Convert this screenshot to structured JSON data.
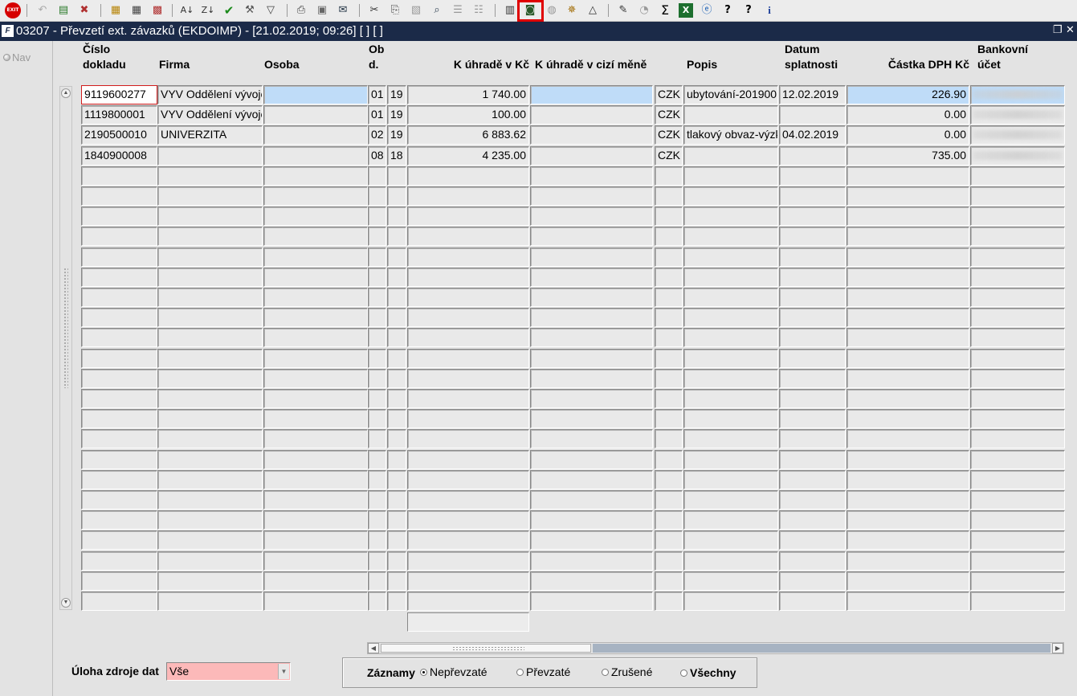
{
  "toolbar": {
    "exit_label": "EXIT",
    "icons": [
      "exit-icon",
      "back-icon",
      "add-record-icon",
      "delete-record-icon",
      "copy-record-icon",
      "copy-record-2-icon",
      "cancel-record-icon",
      "sort-ascending-icon",
      "sort-descending-icon",
      "checkmark-icon",
      "wrench-icon",
      "filter-icon",
      "print-icon",
      "print-preview-icon",
      "mail-icon",
      "cut-icon",
      "copy-icon",
      "paste-icon",
      "search-icon",
      "indent-icon",
      "align-icon",
      "calculator-icon",
      "save-icon",
      "globe-icon",
      "settings-wheel-icon",
      "triangle-icon",
      "edit-note-icon",
      "chart-icon",
      "sum-icon",
      "excel-icon",
      "browser-icon",
      "help-context-icon",
      "help-icon",
      "info-icon"
    ],
    "highlighted_icon": "save-icon"
  },
  "titlebar": {
    "title": "03207 - Převzetí ext. závazků (EKDOIMP) - [21.02.2019; 09:26]  [ ]  [ ]",
    "app_icon": "F",
    "restore_glyph": "❐",
    "close_glyph": "✕"
  },
  "nav": {
    "label": "Nav"
  },
  "columns": {
    "cislo_l1": "Číslo",
    "cislo_l2": "dokladu",
    "firma": "Firma",
    "osoba": "Osoba",
    "obd_l1": "Ob",
    "obd_l2": "d.",
    "k_uhrade_kc": "K úhradě v Kč",
    "k_uhrade_cizi": "K úhradě v cizí měně",
    "popis": "Popis",
    "datum_l1": "Datum",
    "datum_l2": "splatnosti",
    "castka_dph": "Částka DPH Kč",
    "bank_l1": "Bankovní",
    "bank_l2": "účet"
  },
  "rows": [
    {
      "cislo": "9119600277",
      "firma": "VYV Oddělení vývoje",
      "osoba": "",
      "obd": "01",
      "rok": "19",
      "kc": "1 740.00",
      "cizi": "",
      "mena": "CZK",
      "popis": "ubytování-201900",
      "datum": "12.02.2019",
      "dph": "226.90",
      "bank": ""
    },
    {
      "cislo": "1119800001",
      "firma": "VYV Oddělení vývoje",
      "osoba": "",
      "obd": "01",
      "rok": "19",
      "kc": "100.00",
      "cizi": "",
      "mena": "CZK",
      "popis": "",
      "datum": "",
      "dph": "0.00",
      "bank": ""
    },
    {
      "cislo": "2190500010",
      "firma": "UNIVERZITA",
      "osoba": "",
      "obd": "02",
      "rok": "19",
      "kc": "6 883.62",
      "cizi": "",
      "mena": "CZK",
      "popis": "tlakový obvaz-výzk",
      "datum": "04.02.2019",
      "dph": "0.00",
      "bank": ""
    },
    {
      "cislo": "1840900008",
      "firma": "",
      "osoba": "",
      "obd": "08",
      "rok": "18",
      "kc": "4 235.00",
      "cizi": "",
      "mena": "CZK",
      "popis": "",
      "datum": "",
      "dph": "735.00",
      "bank": ""
    }
  ],
  "footer": {
    "uloha_label": "Úloha zdroje dat",
    "uloha_value": "Vše",
    "zaznamy_label": "Záznamy",
    "radios": [
      {
        "label": "Nepřevzaté",
        "selected": true
      },
      {
        "label": "Převzaté",
        "selected": false
      },
      {
        "label": "Zrušené",
        "selected": false
      },
      {
        "label": "Všechny",
        "selected": false
      }
    ]
  }
}
